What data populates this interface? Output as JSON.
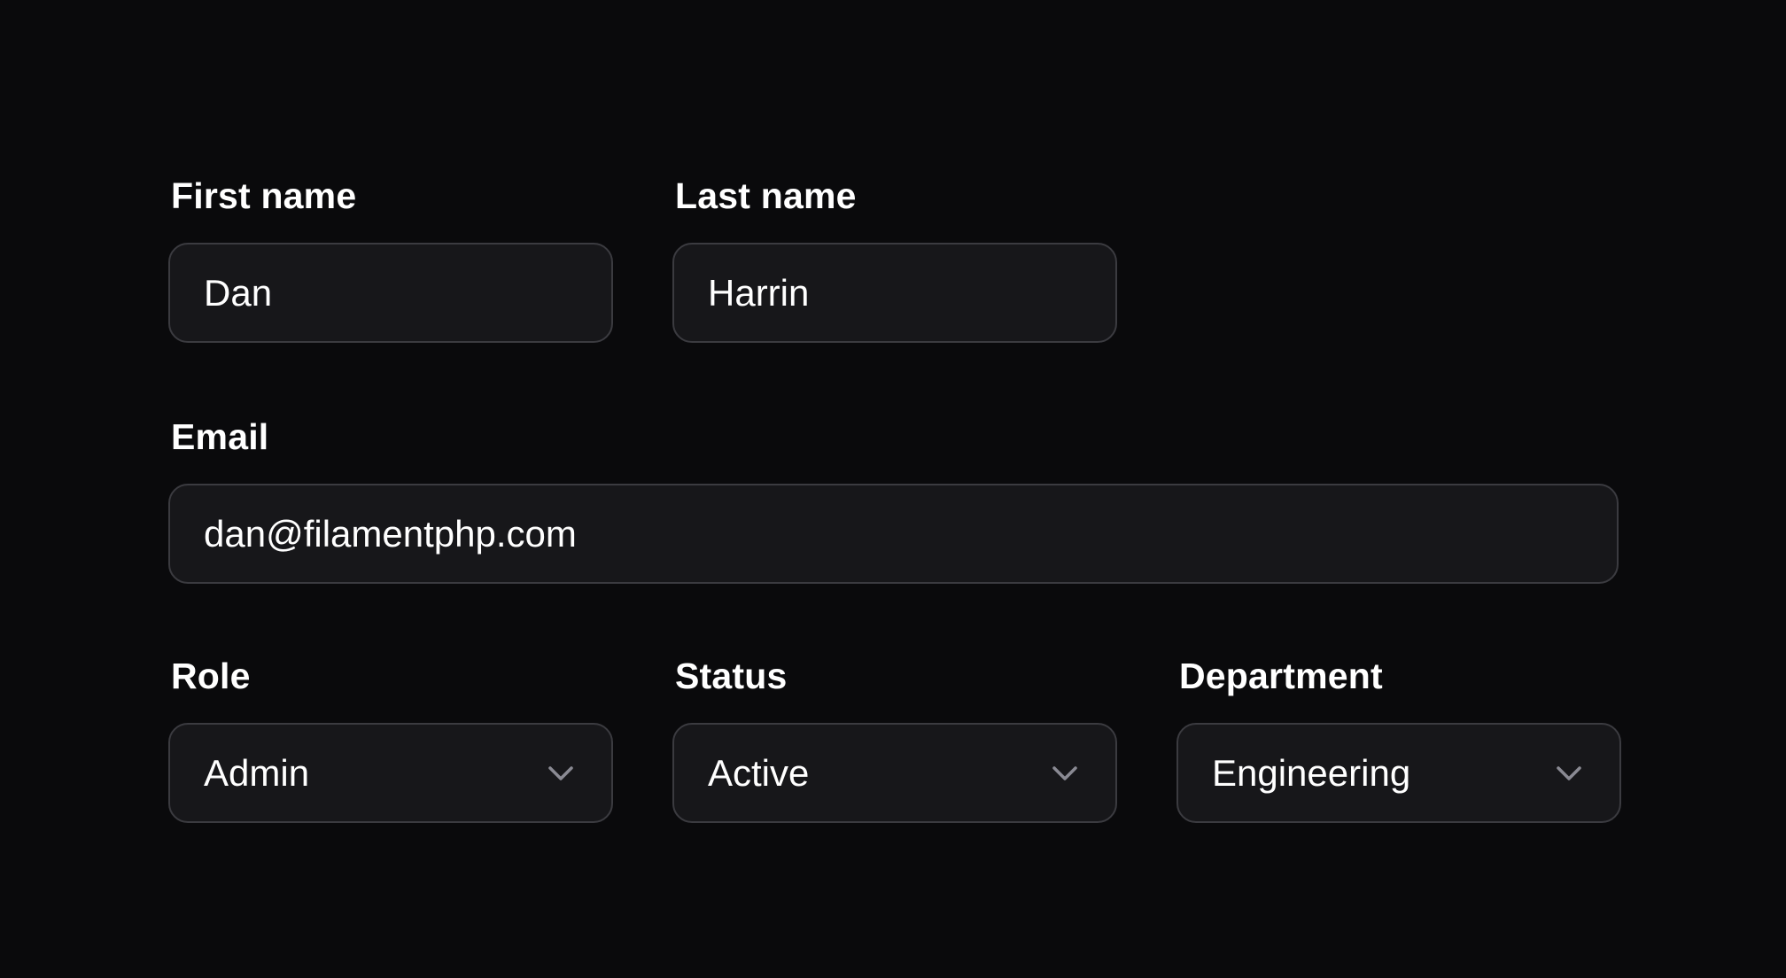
{
  "form": {
    "first_name": {
      "label": "First name",
      "value": "Dan"
    },
    "last_name": {
      "label": "Last name",
      "value": "Harrin"
    },
    "email": {
      "label": "Email",
      "value": "dan@filamentphp.com"
    },
    "role": {
      "label": "Role",
      "selected": "Admin",
      "icon": "chevron-down-icon"
    },
    "status": {
      "label": "Status",
      "selected": "Active",
      "icon": "chevron-down-icon"
    },
    "department": {
      "label": "Department",
      "selected": "Engineering",
      "icon": "chevron-down-icon"
    }
  },
  "colors": {
    "background": "#0a0a0c",
    "field_background": "#17171a",
    "field_border": "#3b3b40",
    "text": "#ffffff",
    "chevron": "#8a8a93"
  }
}
